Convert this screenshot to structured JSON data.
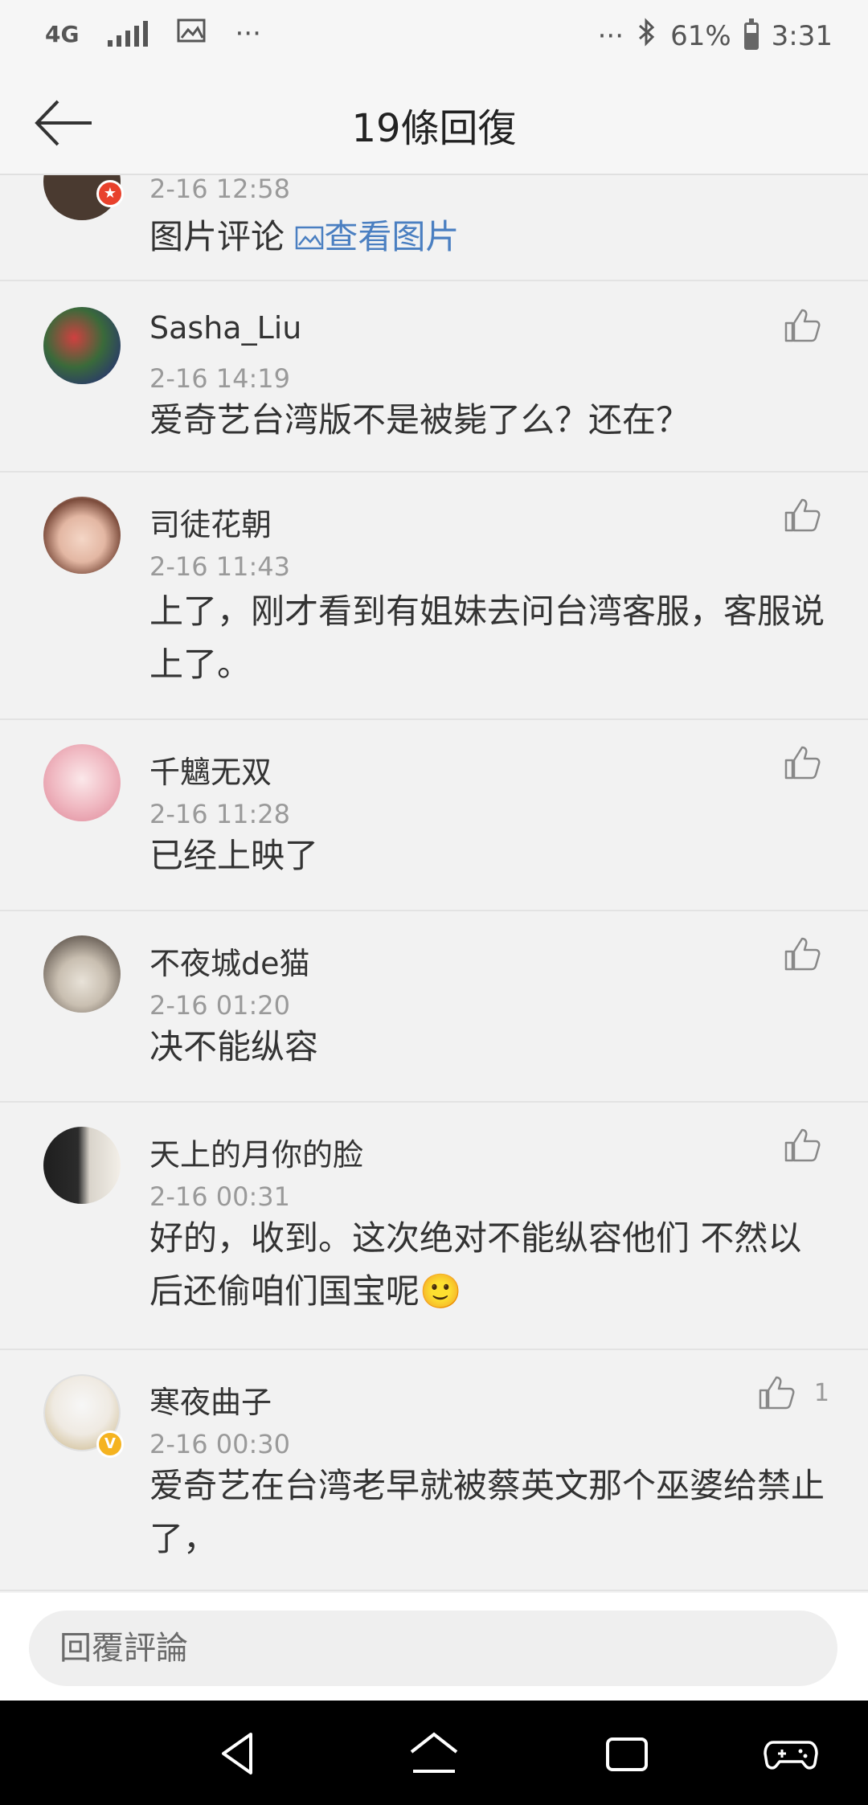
{
  "status_bar": {
    "network": "4G",
    "dots_left": "···",
    "dots_right": "···",
    "battery_percent": "61%",
    "battery_level": 0.61,
    "time": "3:31"
  },
  "header": {
    "title": "19條回復"
  },
  "comments": [
    {
      "name": "",
      "time": "2-16 12:58",
      "text_prefix": "图片评论",
      "link": "查看图片",
      "badge": "red-star"
    },
    {
      "name": "Sasha_Liu",
      "time": "2-16 14:19",
      "text": "爱奇艺台湾版不是被毙了么？还在？"
    },
    {
      "name": "司徒花朝",
      "time": "2-16 11:43",
      "text": "上了，刚才看到有姐妹去问台湾客服，客服说上了。"
    },
    {
      "name": "千魑无双",
      "time": "2-16 11:28",
      "text": "已经上映了"
    },
    {
      "name": "不夜城de猫",
      "time": "2-16 01:20",
      "text": "决不能纵容"
    },
    {
      "name": "天上的月你的脸",
      "time": "2-16 00:31",
      "text": "好的，收到。这次绝对不能纵容他们 不然以后还偷咱们国宝呢🙂"
    },
    {
      "name": "寒夜曲子",
      "time": "2-16 00:30",
      "text": "爱奇艺在台湾老早就被蔡英文那个巫婆给禁止了，",
      "likes": "1",
      "badge": "verified-v"
    }
  ],
  "reply_bar": {
    "placeholder": "回覆評論"
  },
  "colors": {
    "background": "#f2f2f2",
    "link": "#4a7fc1",
    "timestamp": "#9a9a9a",
    "verified_badge": "#f5b320",
    "red_badge": "#e8412c"
  }
}
